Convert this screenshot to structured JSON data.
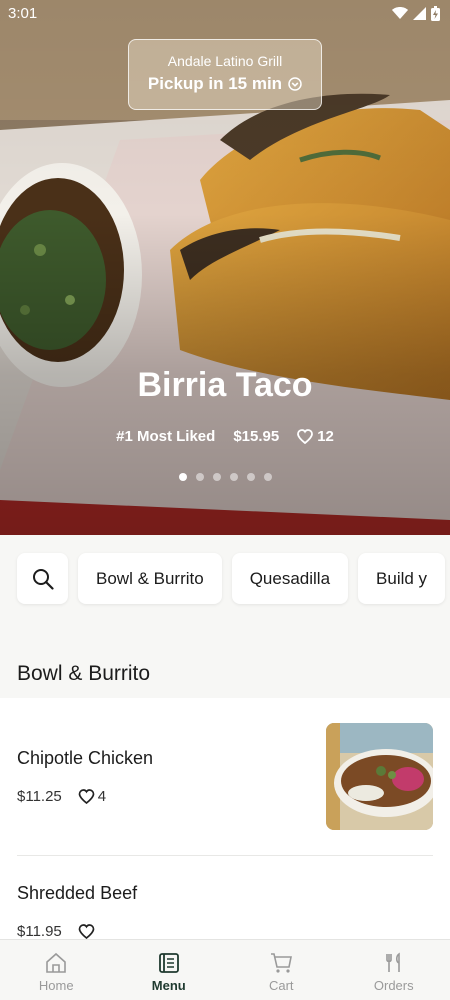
{
  "status_bar": {
    "time": "3:01"
  },
  "header": {
    "restaurant_name": "Andale Latino Grill",
    "pickup_text": "Pickup in 15 min"
  },
  "hero": {
    "title": "Birria Taco",
    "rank_label": "#1 Most Liked",
    "price": "$15.95",
    "likes": "12",
    "carousel": {
      "total": 6,
      "active_index": 0
    }
  },
  "categories": [
    {
      "label": "Bowl & Burrito"
    },
    {
      "label": "Quesadilla"
    },
    {
      "label": "Build y"
    }
  ],
  "section": {
    "title": "Bowl & Burrito"
  },
  "menu_items": [
    {
      "name": "Chipotle Chicken",
      "price": "$11.25",
      "likes": "4"
    },
    {
      "name": "Shredded Beef",
      "price": "$11.95",
      "likes": ""
    }
  ],
  "bottom_nav": [
    {
      "label": "Home",
      "icon": "home-icon"
    },
    {
      "label": "Menu",
      "icon": "menu-icon"
    },
    {
      "label": "Cart",
      "icon": "cart-icon"
    },
    {
      "label": "Orders",
      "icon": "fork-knife-icon"
    }
  ],
  "colors": {
    "accent": "#1f3a2f",
    "inactive": "#9a9a9a",
    "background": "#f7f7f5"
  }
}
